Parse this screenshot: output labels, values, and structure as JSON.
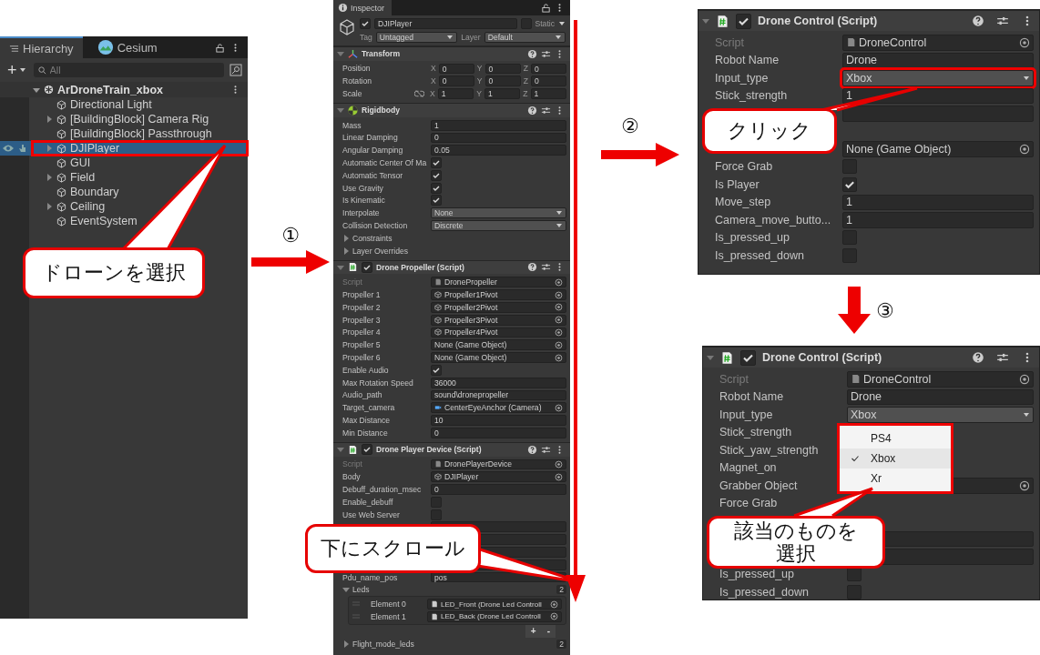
{
  "hierarchy": {
    "tabs": [
      {
        "label": "Hierarchy",
        "selected": true
      },
      {
        "label": "Cesium",
        "selected": false
      }
    ],
    "add_button": "+",
    "search": {
      "placeholder": "All"
    },
    "scene": {
      "name": "ArDroneTrain_xbox",
      "expanded": true
    },
    "items": [
      {
        "name": "Directional Light",
        "expandable": false,
        "selected": false,
        "highlighted": false
      },
      {
        "name": "[BuildingBlock] Camera Rig",
        "expandable": true,
        "selected": false,
        "highlighted": false
      },
      {
        "name": "[BuildingBlock] Passthrough",
        "expandable": false,
        "selected": false,
        "highlighted": false
      },
      {
        "name": "DJIPlayer",
        "expandable": true,
        "selected": true,
        "highlighted": true
      },
      {
        "name": "GUI",
        "expandable": false,
        "selected": false,
        "highlighted": false
      },
      {
        "name": "Field",
        "expandable": true,
        "selected": false,
        "highlighted": false
      },
      {
        "name": "Boundary",
        "expandable": false,
        "selected": false,
        "highlighted": false
      },
      {
        "name": "Ceiling",
        "expandable": true,
        "selected": false,
        "highlighted": false
      },
      {
        "name": "EventSystem",
        "expandable": false,
        "selected": false,
        "highlighted": false
      }
    ],
    "callout": "ドローンを選択"
  },
  "panels": [
    {
      "tab": "Inspector",
      "object": {
        "name": "DJIPlayer",
        "active": true,
        "static": false,
        "static_label": "Static",
        "tag_label": "Tag",
        "tag": "Untagged",
        "layer_label": "Layer",
        "layer": "Default"
      },
      "components": [
        {
          "title": "Transform",
          "kind": "transform",
          "rows": [
            {
              "kind": "vector",
              "label": "Position",
              "values": [
                {
                  "axis": "X",
                  "value": "0"
                },
                {
                  "axis": "Y",
                  "value": "0"
                },
                {
                  "axis": "Z",
                  "value": "0"
                }
              ]
            },
            {
              "kind": "vector",
              "label": "Rotation",
              "values": [
                {
                  "axis": "X",
                  "value": "0"
                },
                {
                  "axis": "Y",
                  "value": "0"
                },
                {
                  "axis": "Z",
                  "value": "0"
                }
              ]
            },
            {
              "kind": "vector",
              "label": "Scale",
              "link_toggle": true,
              "values": [
                {
                  "axis": "X",
                  "value": "1"
                },
                {
                  "axis": "Y",
                  "value": "1"
                },
                {
                  "axis": "Z",
                  "value": "1"
                }
              ]
            }
          ]
        },
        {
          "title": "Rigidbody",
          "kind": "rigidbody",
          "rows": [
            {
              "kind": "field",
              "label": "Mass",
              "value": "1"
            },
            {
              "kind": "field",
              "label": "Linear Damping",
              "value": "0"
            },
            {
              "kind": "field",
              "label": "Angular Damping",
              "value": "0.05"
            },
            {
              "kind": "check",
              "label": "Automatic Center Of Ma",
              "checked": true
            },
            {
              "kind": "check",
              "label": "Automatic Tensor",
              "checked": true
            },
            {
              "kind": "check",
              "label": "Use Gravity",
              "checked": true
            },
            {
              "kind": "check",
              "label": "Is Kinematic",
              "checked": true
            },
            {
              "kind": "dropdown",
              "label": "Interpolate",
              "value": "None",
              "highlighted": false
            },
            {
              "kind": "dropdown",
              "label": "Collision Detection",
              "value": "Discrete",
              "highlighted": false
            },
            {
              "kind": "fold",
              "label": "Constraints"
            },
            {
              "kind": "fold",
              "label": "Layer Overrides"
            }
          ]
        },
        {
          "title": "Drone Propeller (Script)",
          "kind": "script",
          "enabled": true,
          "rows": [
            {
              "kind": "script",
              "label": "Script",
              "value": "DronePropeller"
            },
            {
              "kind": "object",
              "label": "Propeller 1",
              "value": "Propeller1Pivot"
            },
            {
              "kind": "object",
              "label": "Propeller 2",
              "value": "Propeller2Pivot"
            },
            {
              "kind": "object",
              "label": "Propeller 3",
              "value": "Propeller3Pivot"
            },
            {
              "kind": "object",
              "label": "Propeller 4",
              "value": "Propeller4Pivot"
            },
            {
              "kind": "none_object",
              "label": "Propeller 5",
              "value": "None (Game Object)"
            },
            {
              "kind": "none_object",
              "label": "Propeller 6",
              "value": "None (Game Object)"
            },
            {
              "kind": "check",
              "label": "Enable Audio",
              "checked": true
            },
            {
              "kind": "field",
              "label": "Max Rotation Speed",
              "value": "36000"
            },
            {
              "kind": "field",
              "label": "Audio_path",
              "value": "sound\\dronepropeller"
            },
            {
              "kind": "camera_object",
              "label": "Target_camera",
              "value": "CenterEyeAnchor (Camera)"
            },
            {
              "kind": "field",
              "label": "Max Distance",
              "value": "10"
            },
            {
              "kind": "field",
              "label": "Min Distance",
              "value": "0"
            }
          ]
        },
        {
          "title": "Drone Player Device (Script)",
          "kind": "script",
          "enabled": true,
          "rows": [
            {
              "kind": "script",
              "label": "Script",
              "value": "DronePlayerDevice"
            },
            {
              "kind": "object",
              "label": "Body",
              "value": "DJIPlayer"
            },
            {
              "kind": "field",
              "label": "Debuff_duration_msec",
              "value": "0"
            },
            {
              "kind": "check",
              "label": "Enable_debuff",
              "checked": false
            },
            {
              "kind": "check",
              "label": "Use Web Server",
              "checked": false
            },
            {
              "kind": "blank"
            },
            {
              "kind": "blank"
            },
            {
              "kind": "blank"
            },
            {
              "kind": "blank"
            },
            {
              "kind": "field",
              "label": "Pdu_name_pos",
              "value": "pos"
            },
            {
              "kind": "list",
              "label": "Leds",
              "count": "2",
              "expanded": true,
              "add": "+",
              "remove": "-",
              "elements": [
                {
                  "label": "Element 0",
                  "value": "LED_Front (Drone Led Controll"
                },
                {
                  "label": "Element 1",
                  "value": "LED_Back (Drone Led Controll"
                }
              ]
            },
            {
              "kind": "list",
              "label": "Flight_mode_leds",
              "count": "2",
              "expanded": false
            }
          ]
        }
      ],
      "callout": "下にスクロール"
    },
    {
      "components": [
        {
          "title": "Drone Control (Script)",
          "kind": "script",
          "enabled": true,
          "rows": [
            {
              "kind": "script",
              "label": "Script",
              "value": "DroneControl"
            },
            {
              "kind": "field",
              "label": "Robot Name",
              "value": "Drone"
            },
            {
              "kind": "dropdown",
              "label": "Input_type",
              "value": "Xbox",
              "highlighted": true
            },
            {
              "kind": "field",
              "label": "Stick_strength",
              "value": "1"
            },
            {
              "kind": "blank"
            },
            {
              "kind": "gap"
            },
            {
              "kind": "none_object",
              "value": "None (Game Object)"
            },
            {
              "kind": "check",
              "label": "Force Grab",
              "checked": false
            },
            {
              "kind": "check",
              "label": "Is Player",
              "checked": true
            },
            {
              "kind": "field",
              "label": "Move_step",
              "value": "1"
            },
            {
              "kind": "field",
              "label": "Camera_move_butto...",
              "value": "1"
            },
            {
              "kind": "check",
              "label": "Is_pressed_up",
              "checked": false
            },
            {
              "kind": "check",
              "label": "Is_pressed_down",
              "checked": false
            }
          ]
        }
      ],
      "callout": "クリック"
    },
    {
      "components": [
        {
          "title": "Drone Control (Script)",
          "kind": "script",
          "enabled": true,
          "rows": [
            {
              "kind": "script",
              "label": "Script",
              "value": "DroneControl"
            },
            {
              "kind": "field",
              "label": "Robot Name",
              "value": "Drone"
            },
            {
              "kind": "dropdown",
              "label": "Input_type",
              "value": "Xbox",
              "highlighted": false
            },
            {
              "kind": "label",
              "label": "Stick_strength"
            },
            {
              "kind": "label",
              "label": "Stick_yaw_strength"
            },
            {
              "kind": "label",
              "label": "Magnet_on"
            },
            {
              "kind": "none_object",
              "label": "Grabber Object"
            },
            {
              "kind": "label",
              "label": "Force Grab"
            },
            {
              "kind": "gap"
            },
            {
              "kind": "blank"
            },
            {
              "kind": "blank"
            },
            {
              "kind": "check",
              "label": "Is_pressed_up",
              "checked": false
            },
            {
              "kind": "check",
              "label": "Is_pressed_down",
              "checked": false
            }
          ]
        }
      ],
      "menu": {
        "highlighted": true,
        "options": [
          {
            "label": "PS4",
            "selected": false
          },
          {
            "label": "Xbox",
            "selected": true
          },
          {
            "label": "Xr",
            "selected": false
          }
        ]
      },
      "callout": "該当のものを選択"
    }
  ],
  "steps": [
    "①",
    "②",
    "③"
  ]
}
